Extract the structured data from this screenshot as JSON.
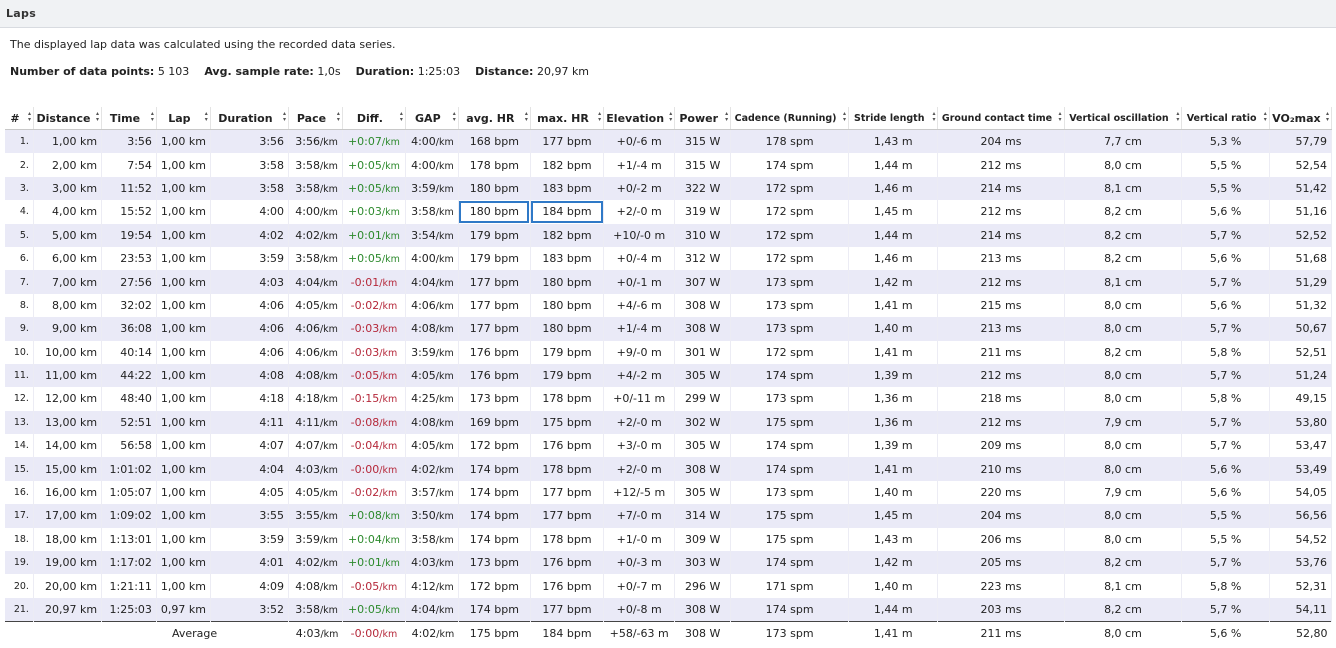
{
  "panel": {
    "title": "Laps"
  },
  "description": "The displayed lap data was calculated using the recorded data series.",
  "stats": [
    {
      "label": "Number of data points:",
      "value": "5 103"
    },
    {
      "label": "Avg. sample rate:",
      "value": "1,0s"
    },
    {
      "label": "Duration:",
      "value": "1:25:03"
    },
    {
      "label": "Distance:",
      "value": "20,97 km"
    }
  ],
  "columns": [
    "#",
    "Distance",
    "Time",
    "Lap",
    "Duration",
    "Pace",
    "Diff.",
    "GAP",
    "avg. HR",
    "max. HR",
    "Elevation",
    "Power",
    "Cadence (Running)",
    "Stride length",
    "Ground contact time",
    "Vertical oscillation",
    "Vertical ratio",
    "VO₂max"
  ],
  "units": {
    "km": "km",
    "pace": "/km",
    "bpm": "bpm",
    "m": "m",
    "w": "W",
    "spm": "spm",
    "ms": "ms",
    "cm": "cm",
    "pct": "%"
  },
  "colors": {
    "positive": "#2d8a2d",
    "negative": "#b5283a",
    "selection": "#2f79c7",
    "row_alt": "#eaeaf7"
  },
  "selected_cells": [
    {
      "row": 4,
      "columns": [
        "avg. HR",
        "max. HR"
      ]
    }
  ],
  "rows": [
    [
      "1.",
      "1,00",
      "3:56",
      "1,00",
      "3:56",
      "3:56",
      "+0:07",
      "4:00",
      "168",
      "177",
      "+0/-6",
      "315",
      "178",
      "1,43",
      "204",
      "7,7",
      "5,3",
      "57,79"
    ],
    [
      "2.",
      "2,00",
      "7:54",
      "1,00",
      "3:58",
      "3:58",
      "+0:05",
      "4:00",
      "178",
      "182",
      "+1/-4",
      "315",
      "174",
      "1,44",
      "212",
      "8,0",
      "5,5",
      "52,54"
    ],
    [
      "3.",
      "3,00",
      "11:52",
      "1,00",
      "3:58",
      "3:58",
      "+0:05",
      "3:59",
      "180",
      "183",
      "+0/-2",
      "322",
      "172",
      "1,46",
      "214",
      "8,1",
      "5,5",
      "51,42"
    ],
    [
      "4.",
      "4,00",
      "15:52",
      "1,00",
      "4:00",
      "4:00",
      "+0:03",
      "3:58",
      "180",
      "184",
      "+2/-0",
      "319",
      "172",
      "1,45",
      "212",
      "8,2",
      "5,6",
      "51,16"
    ],
    [
      "5.",
      "5,00",
      "19:54",
      "1,00",
      "4:02",
      "4:02",
      "+0:01",
      "3:54",
      "179",
      "182",
      "+10/-0",
      "310",
      "172",
      "1,44",
      "214",
      "8,2",
      "5,7",
      "52,52"
    ],
    [
      "6.",
      "6,00",
      "23:53",
      "1,00",
      "3:59",
      "3:58",
      "+0:05",
      "4:00",
      "179",
      "183",
      "+0/-4",
      "312",
      "172",
      "1,46",
      "213",
      "8,2",
      "5,6",
      "51,68"
    ],
    [
      "7.",
      "7,00",
      "27:56",
      "1,00",
      "4:03",
      "4:04",
      "-0:01",
      "4:04",
      "177",
      "180",
      "+0/-1",
      "307",
      "173",
      "1,42",
      "212",
      "8,1",
      "5,7",
      "51,29"
    ],
    [
      "8.",
      "8,00",
      "32:02",
      "1,00",
      "4:06",
      "4:05",
      "-0:02",
      "4:06",
      "177",
      "180",
      "+4/-6",
      "308",
      "173",
      "1,41",
      "215",
      "8,0",
      "5,6",
      "51,32"
    ],
    [
      "9.",
      "9,00",
      "36:08",
      "1,00",
      "4:06",
      "4:06",
      "-0:03",
      "4:08",
      "177",
      "180",
      "+1/-4",
      "308",
      "173",
      "1,40",
      "213",
      "8,0",
      "5,7",
      "50,67"
    ],
    [
      "10.",
      "10,00",
      "40:14",
      "1,00",
      "4:06",
      "4:06",
      "-0:03",
      "3:59",
      "176",
      "179",
      "+9/-0",
      "301",
      "172",
      "1,41",
      "211",
      "8,2",
      "5,8",
      "52,51"
    ],
    [
      "11.",
      "11,00",
      "44:22",
      "1,00",
      "4:08",
      "4:08",
      "-0:05",
      "4:05",
      "176",
      "179",
      "+4/-2",
      "305",
      "174",
      "1,39",
      "212",
      "8,0",
      "5,7",
      "51,24"
    ],
    [
      "12.",
      "12,00",
      "48:40",
      "1,00",
      "4:18",
      "4:18",
      "-0:15",
      "4:25",
      "173",
      "178",
      "+0/-11",
      "299",
      "173",
      "1,36",
      "218",
      "8,0",
      "5,8",
      "49,15"
    ],
    [
      "13.",
      "13,00",
      "52:51",
      "1,00",
      "4:11",
      "4:11",
      "-0:08",
      "4:08",
      "169",
      "175",
      "+2/-0",
      "302",
      "175",
      "1,36",
      "212",
      "7,9",
      "5,7",
      "53,80"
    ],
    [
      "14.",
      "14,00",
      "56:58",
      "1,00",
      "4:07",
      "4:07",
      "-0:04",
      "4:05",
      "172",
      "176",
      "+3/-0",
      "305",
      "174",
      "1,39",
      "209",
      "8,0",
      "5,7",
      "53,47"
    ],
    [
      "15.",
      "15,00",
      "1:01:02",
      "1,00",
      "4:04",
      "4:03",
      "-0:00",
      "4:02",
      "174",
      "178",
      "+2/-0",
      "308",
      "174",
      "1,41",
      "210",
      "8,0",
      "5,6",
      "53,49"
    ],
    [
      "16.",
      "16,00",
      "1:05:07",
      "1,00",
      "4:05",
      "4:05",
      "-0:02",
      "3:57",
      "174",
      "177",
      "+12/-5",
      "305",
      "173",
      "1,40",
      "220",
      "7,9",
      "5,6",
      "54,05"
    ],
    [
      "17.",
      "17,00",
      "1:09:02",
      "1,00",
      "3:55",
      "3:55",
      "+0:08",
      "3:50",
      "174",
      "177",
      "+7/-0",
      "314",
      "175",
      "1,45",
      "204",
      "8,0",
      "5,5",
      "56,56"
    ],
    [
      "18.",
      "18,00",
      "1:13:01",
      "1,00",
      "3:59",
      "3:59",
      "+0:04",
      "3:58",
      "174",
      "178",
      "+1/-0",
      "309",
      "175",
      "1,43",
      "206",
      "8,0",
      "5,5",
      "54,52"
    ],
    [
      "19.",
      "19,00",
      "1:17:02",
      "1,00",
      "4:01",
      "4:02",
      "+0:01",
      "4:03",
      "173",
      "176",
      "+0/-3",
      "303",
      "174",
      "1,42",
      "205",
      "8,2",
      "5,7",
      "53,76"
    ],
    [
      "20.",
      "20,00",
      "1:21:11",
      "1,00",
      "4:09",
      "4:08",
      "-0:05",
      "4:12",
      "172",
      "176",
      "+0/-7",
      "296",
      "171",
      "1,40",
      "223",
      "8,1",
      "5,8",
      "52,31"
    ],
    [
      "21.",
      "20,97",
      "1:25:03",
      "0,97",
      "3:52",
      "3:58",
      "+0:05",
      "4:04",
      "174",
      "177",
      "+0/-8",
      "308",
      "174",
      "1,44",
      "203",
      "8,2",
      "5,7",
      "54,11"
    ]
  ],
  "average": {
    "label": "Average",
    "values": [
      "4:03",
      "-0:00",
      "4:02",
      "175",
      "184",
      "+58/-63",
      "308",
      "173",
      "1,41",
      "211",
      "8,0",
      "5,6",
      "52,80"
    ]
  }
}
